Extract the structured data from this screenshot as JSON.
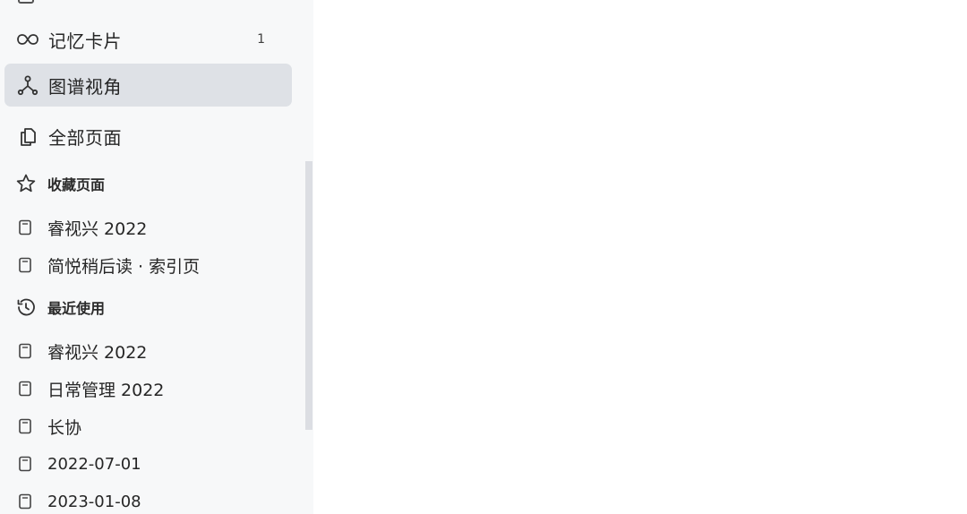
{
  "nav": {
    "flashcards": {
      "label": "记忆卡片",
      "count": "1",
      "icon": "infinity-icon"
    },
    "graph_view": {
      "label": "图谱视角",
      "icon": "graph-icon"
    },
    "all_pages": {
      "label": "全部页面",
      "icon": "pages-icon"
    }
  },
  "favorites": {
    "title": "收藏页面",
    "icon": "star-icon",
    "items": [
      {
        "label": "睿视兴 2022"
      },
      {
        "label": "简悦稍后读 · 索引页"
      }
    ]
  },
  "recent": {
    "title": "最近使用",
    "icon": "history-icon",
    "items": [
      {
        "label": "睿视兴 2022"
      },
      {
        "label": "日常管理 2022"
      },
      {
        "label": "长协"
      },
      {
        "label": "2022-07-01"
      },
      {
        "label": "2023-01-08"
      }
    ]
  },
  "colors": {
    "sidebar_bg": "#f7f8f9",
    "active_bg": "#dee1e6",
    "scrollbar": "#dcdee3"
  }
}
